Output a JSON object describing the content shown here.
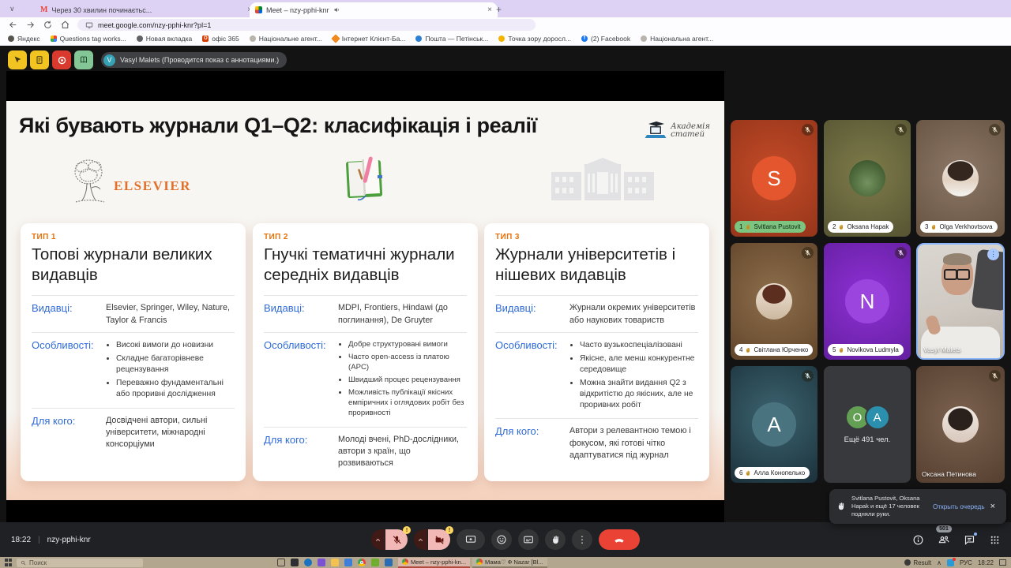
{
  "colors": {
    "accent_blue": "#2f6bd8",
    "type_orange": "#e8710a",
    "hangup_red": "#ea4335",
    "raise_hand_green": "#7cc480",
    "speaking_border": "#8ab4f8"
  },
  "browser": {
    "tabs": [
      {
        "title": "Через 30 хвилин починаєтьс...",
        "icon": "gmail"
      },
      {
        "title": "Meet – nzy-pphi-knr",
        "icon": "meet",
        "active": true,
        "audio": true
      }
    ],
    "url": "meet.google.com/nzy-pphi-knr?pl=1",
    "bookmarks": [
      "Яндекс",
      "Questions tag works...",
      "Новая вкладка",
      "офіс 365",
      "Національне агент...",
      "Інтернет Клієнт-Ба...",
      "Пошта — Петінськ...",
      "Точка зору доросл...",
      "(2) Facebook",
      "Національна агент..."
    ]
  },
  "annotation_bar": {
    "presenter_initial": "V",
    "presenter": "Vasyl Malets (Проводится показ с аннотациями.)"
  },
  "slide": {
    "title": "Які бувають журнали Q1–Q2: класифікація і реалії",
    "logo_text_1": "Академія",
    "logo_text_2": "статей",
    "elsevier_text": "ELSEVIER",
    "columns": [
      {
        "type_label": "ТИП 1",
        "title": "Топові журнали великих видавців",
        "publishers_label": "Видавці:",
        "publishers": "Elsevier, Springer, Wiley, Nature, Taylor & Francis",
        "features_label": "Особливості:",
        "features": [
          "Високі вимоги до новизни",
          "Складне багаторівневе рецензування",
          "Переважно фундаментальні або проривні дослідження"
        ],
        "for_label": "Для кого:",
        "for_whom": "Досвідчені автори, сильні університети, міжнародні консорціуми"
      },
      {
        "type_label": "ТИП 2",
        "title": "Гнучкі тематичні журнали середніх видавців",
        "publishers_label": "Видавці:",
        "publishers": "MDPI, Frontiers, Hindawi (до поглинання), De Gruyter",
        "features_label": "Особливості:",
        "features": [
          "Добре структуровані вимоги",
          "Часто open-access із платою (APC)",
          "Швидший процес рецензування",
          "Можливість публікації якісних емпіричних і оглядових робіт без проривності"
        ],
        "for_label": "Для кого:",
        "for_whom": "Молоді вчені, PhD-дослідники, автори з країн, що розвиваються"
      },
      {
        "type_label": "ТИП 3",
        "title": "Журнали університетів і нішевих видавців",
        "publishers_label": "Видавці:",
        "publishers": "Журнали окремих університетів або наукових товариств",
        "features_label": "Особливості:",
        "features": [
          "Часто вузькоспеціалізовані",
          "Якісне, але менш конкурентне середовище",
          "Можна знайти видання Q2 з відкритістю до якісних, але не проривних робіт"
        ],
        "for_label": "Для кого:",
        "for_whom": "Автори з релевантною темою і фокусом, які готові чітко адаптуватися під журнал"
      }
    ]
  },
  "participants": {
    "tiles": [
      {
        "queue": "1",
        "name": "Svitlana Pustovit",
        "initial": "S"
      },
      {
        "queue": "2",
        "name": "Oksana Hapak"
      },
      {
        "queue": "3",
        "name": "Olga Verkhovtsova"
      },
      {
        "queue": "4",
        "name": "Світлана Юрченко"
      },
      {
        "queue": "5",
        "name": "Novikova Ludmyla",
        "initial": "N"
      },
      {
        "name": "Vasyl Malets"
      },
      {
        "queue": "6",
        "name": "Алла Конопелько",
        "initial": "A"
      },
      {
        "more_label": "Ещё 491 чел.",
        "initials": [
          "O",
          "A"
        ]
      },
      {
        "name": "Оксана Петинова"
      }
    ]
  },
  "toast": {
    "text": "Svitlana Pustovit, Oksana Hapak и ещё 17 человек подняли руки.",
    "action": "Открыть очередь"
  },
  "meet_bar": {
    "time": "18:22",
    "code": "nzy-pphi-knr",
    "people_count": "501"
  },
  "taskbar": {
    "search_placeholder": "Поиск",
    "windows": [
      {
        "title": "Meet – nzy-pphi-kn..."
      },
      {
        "title": "Мама♡ Ф Nazar [Bl..."
      }
    ],
    "tray": {
      "app": "Result",
      "lang": "РУС",
      "time": "18:22"
    }
  }
}
